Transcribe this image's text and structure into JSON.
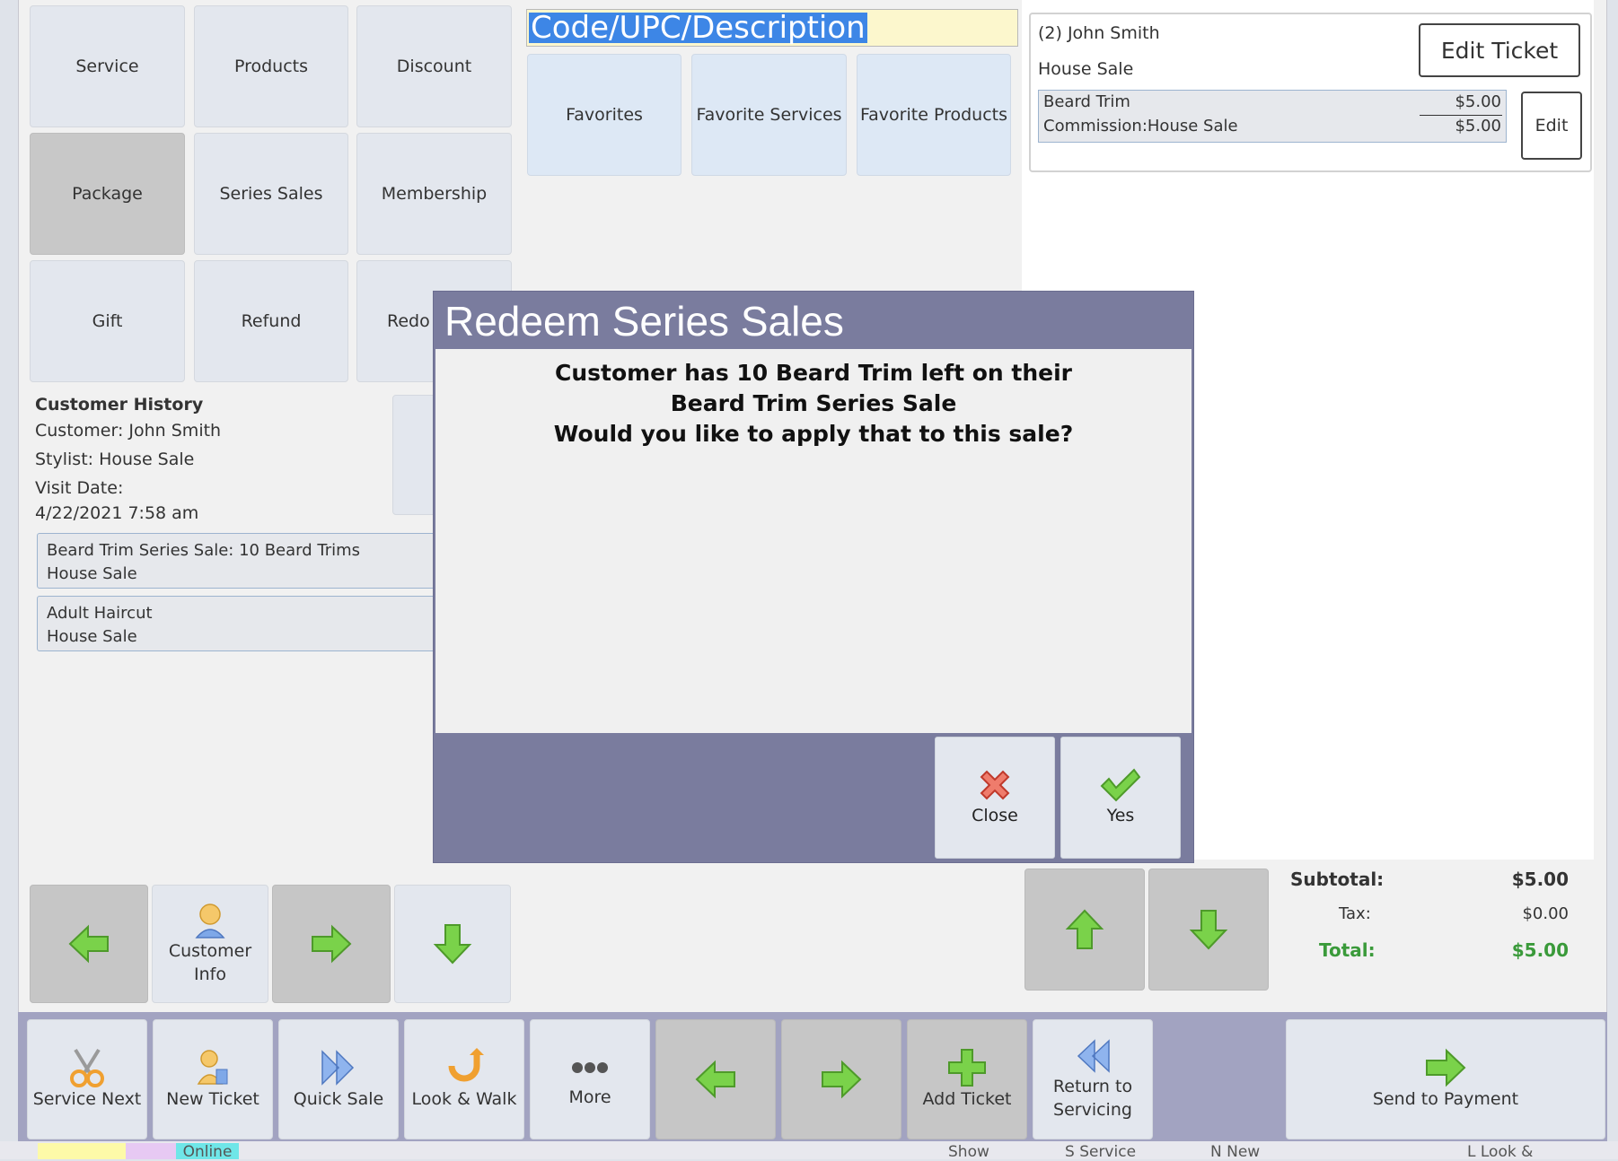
{
  "categories": [
    "Service",
    "Products",
    "Discount",
    "Package",
    "Series Sales",
    "Membership",
    "Gift",
    "Refund",
    "Redo S"
  ],
  "search": {
    "value": "Code/UPC/Description"
  },
  "favorites": [
    "Favorites",
    "Favorite Services",
    "Favorite Products"
  ],
  "ticket": {
    "customer": "(2) John Smith",
    "stylist": "House Sale",
    "edit_ticket_label": "Edit Ticket",
    "edit_label": "Edit",
    "line_item": {
      "name": "Beard Trim",
      "price": "$5.00",
      "commission": "Commission:House Sale",
      "commission_amount": "$5.00"
    }
  },
  "history": {
    "heading": "Customer History",
    "customer": "Customer: John Smith",
    "stylist": "Stylist: House Sale",
    "visit_label": "Visit Date:",
    "visit_date": "4/22/2021 7:58 am",
    "items": [
      {
        "line1": "Beard Trim Series Sale: 10 Beard Trims",
        "line2": "House Sale"
      },
      {
        "line1": "Adult Haircut",
        "line2": "House Sale"
      }
    ]
  },
  "dialog": {
    "title": "Redeem Series Sales",
    "message": [
      "Customer has 10 Beard Trim left on their",
      "Beard Trim Series Sale",
      "Would you like to apply that to this sale?"
    ],
    "close_label": "Close",
    "yes_label": "Yes"
  },
  "nav": {
    "customer_info": [
      "Customer",
      "Info"
    ]
  },
  "totals": {
    "subtotal_label": "Subtotal:",
    "subtotal": "$5.00",
    "tax_label": "Tax:",
    "tax": "$0.00",
    "total_label": "Total:",
    "total": "$5.00"
  },
  "toolbar": {
    "service_next": "Service Next",
    "new_ticket": "New Ticket",
    "quick_sale": "Quick Sale",
    "look_walk": "Look & Walk",
    "more": "More",
    "add_ticket": "Add Ticket",
    "return_servicing": [
      "Return to",
      "Servicing"
    ],
    "send_payment": "Send to Payment"
  },
  "bottom_strip": {
    "online": "Online",
    "show": "Show",
    "service": "S Service",
    "new": "N New",
    "look": "L Look &"
  },
  "colors": {
    "dialog_header": "#7a7c9e",
    "toolbar": "#a2a3c1",
    "total_green": "#3a9a3a",
    "search_bg": "#fcf7cd",
    "selection": "#3d86e6"
  }
}
